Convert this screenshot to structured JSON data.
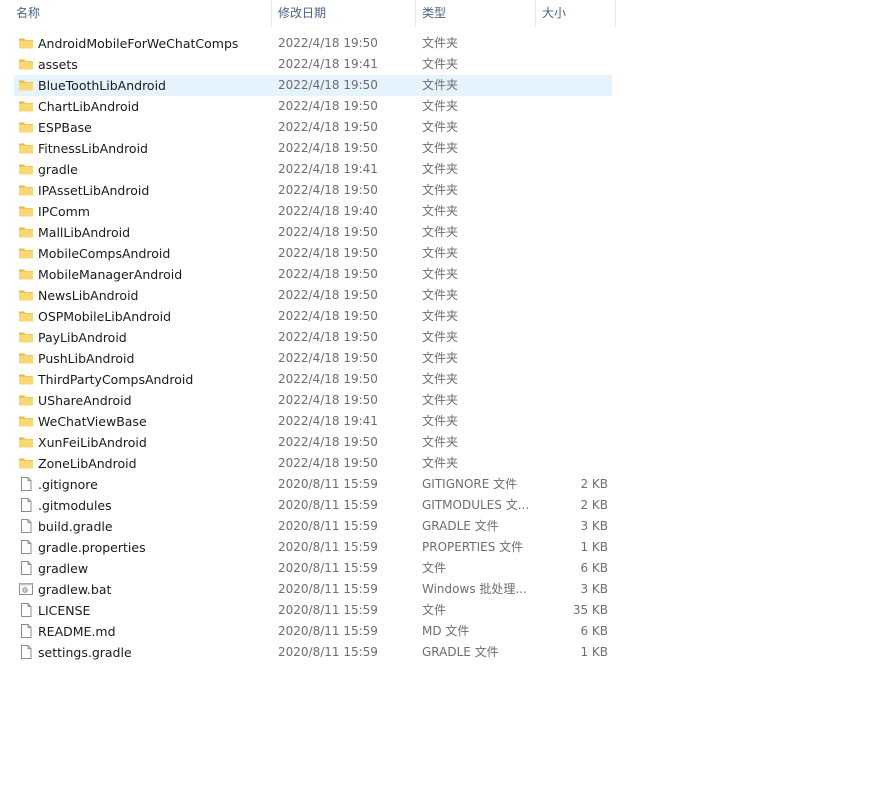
{
  "columns": {
    "name": "名称",
    "date": "修改日期",
    "type": "类型",
    "size": "大小",
    "sort_indicator": "^"
  },
  "colors": {
    "folder": "#f8d775",
    "folder_dark": "#e8b54a",
    "hover": "#e5f3ff",
    "header_text": "#4d6082"
  },
  "items": [
    {
      "kind": "folder",
      "icon": "folder-icon",
      "name": "AndroidMobileForWeChatComps",
      "date": "2022/4/18 19:50",
      "type": "文件夹",
      "size": ""
    },
    {
      "kind": "folder",
      "icon": "folder-icon",
      "name": "assets",
      "date": "2022/4/18 19:41",
      "type": "文件夹",
      "size": ""
    },
    {
      "kind": "folder",
      "icon": "folder-icon",
      "name": "BlueToothLibAndroid",
      "date": "2022/4/18 19:50",
      "type": "文件夹",
      "size": "",
      "hover": true
    },
    {
      "kind": "folder",
      "icon": "folder-icon",
      "name": "ChartLibAndroid",
      "date": "2022/4/18 19:50",
      "type": "文件夹",
      "size": ""
    },
    {
      "kind": "folder",
      "icon": "folder-icon",
      "name": "ESPBase",
      "date": "2022/4/18 19:50",
      "type": "文件夹",
      "size": ""
    },
    {
      "kind": "folder",
      "icon": "folder-icon",
      "name": "FitnessLibAndroid",
      "date": "2022/4/18 19:50",
      "type": "文件夹",
      "size": ""
    },
    {
      "kind": "folder",
      "icon": "folder-icon",
      "name": "gradle",
      "date": "2022/4/18 19:41",
      "type": "文件夹",
      "size": ""
    },
    {
      "kind": "folder",
      "icon": "folder-icon",
      "name": "IPAssetLibAndroid",
      "date": "2022/4/18 19:50",
      "type": "文件夹",
      "size": ""
    },
    {
      "kind": "folder",
      "icon": "folder-icon",
      "name": "IPComm",
      "date": "2022/4/18 19:40",
      "type": "文件夹",
      "size": ""
    },
    {
      "kind": "folder",
      "icon": "folder-icon",
      "name": "MallLibAndroid",
      "date": "2022/4/18 19:50",
      "type": "文件夹",
      "size": ""
    },
    {
      "kind": "folder",
      "icon": "folder-icon",
      "name": "MobileCompsAndroid",
      "date": "2022/4/18 19:50",
      "type": "文件夹",
      "size": ""
    },
    {
      "kind": "folder",
      "icon": "folder-icon",
      "name": "MobileManagerAndroid",
      "date": "2022/4/18 19:50",
      "type": "文件夹",
      "size": ""
    },
    {
      "kind": "folder",
      "icon": "folder-icon",
      "name": "NewsLibAndroid",
      "date": "2022/4/18 19:50",
      "type": "文件夹",
      "size": ""
    },
    {
      "kind": "folder",
      "icon": "folder-icon",
      "name": "OSPMobileLibAndroid",
      "date": "2022/4/18 19:50",
      "type": "文件夹",
      "size": ""
    },
    {
      "kind": "folder",
      "icon": "folder-icon",
      "name": "PayLibAndroid",
      "date": "2022/4/18 19:50",
      "type": "文件夹",
      "size": ""
    },
    {
      "kind": "folder",
      "icon": "folder-icon",
      "name": "PushLibAndroid",
      "date": "2022/4/18 19:50",
      "type": "文件夹",
      "size": ""
    },
    {
      "kind": "folder",
      "icon": "folder-icon",
      "name": "ThirdPartyCompsAndroid",
      "date": "2022/4/18 19:50",
      "type": "文件夹",
      "size": ""
    },
    {
      "kind": "folder",
      "icon": "folder-icon",
      "name": "UShareAndroid",
      "date": "2022/4/18 19:50",
      "type": "文件夹",
      "size": ""
    },
    {
      "kind": "folder",
      "icon": "folder-icon",
      "name": "WeChatViewBase",
      "date": "2022/4/18 19:41",
      "type": "文件夹",
      "size": ""
    },
    {
      "kind": "folder",
      "icon": "folder-icon",
      "name": "XunFeiLibAndroid",
      "date": "2022/4/18 19:50",
      "type": "文件夹",
      "size": ""
    },
    {
      "kind": "folder",
      "icon": "folder-icon",
      "name": "ZoneLibAndroid",
      "date": "2022/4/18 19:50",
      "type": "文件夹",
      "size": ""
    },
    {
      "kind": "file",
      "icon": "file-icon",
      "name": ".gitignore",
      "date": "2020/8/11 15:59",
      "type": "GITIGNORE 文件",
      "size": "2 KB"
    },
    {
      "kind": "file",
      "icon": "file-icon",
      "name": ".gitmodules",
      "date": "2020/8/11 15:59",
      "type": "GITMODULES 文...",
      "size": "2 KB"
    },
    {
      "kind": "file",
      "icon": "file-icon",
      "name": "build.gradle",
      "date": "2020/8/11 15:59",
      "type": "GRADLE 文件",
      "size": "3 KB"
    },
    {
      "kind": "file",
      "icon": "file-icon",
      "name": "gradle.properties",
      "date": "2020/8/11 15:59",
      "type": "PROPERTIES 文件",
      "size": "1 KB"
    },
    {
      "kind": "file",
      "icon": "file-icon",
      "name": "gradlew",
      "date": "2020/8/11 15:59",
      "type": "文件",
      "size": "6 KB"
    },
    {
      "kind": "bat",
      "icon": "batch-file-icon",
      "name": "gradlew.bat",
      "date": "2020/8/11 15:59",
      "type": "Windows 批处理...",
      "size": "3 KB"
    },
    {
      "kind": "file",
      "icon": "file-icon",
      "name": "LICENSE",
      "date": "2020/8/11 15:59",
      "type": "文件",
      "size": "35 KB"
    },
    {
      "kind": "file",
      "icon": "file-icon",
      "name": "README.md",
      "date": "2020/8/11 15:59",
      "type": "MD 文件",
      "size": "6 KB"
    },
    {
      "kind": "file",
      "icon": "file-icon",
      "name": "settings.gradle",
      "date": "2020/8/11 15:59",
      "type": "GRADLE 文件",
      "size": "1 KB"
    }
  ]
}
